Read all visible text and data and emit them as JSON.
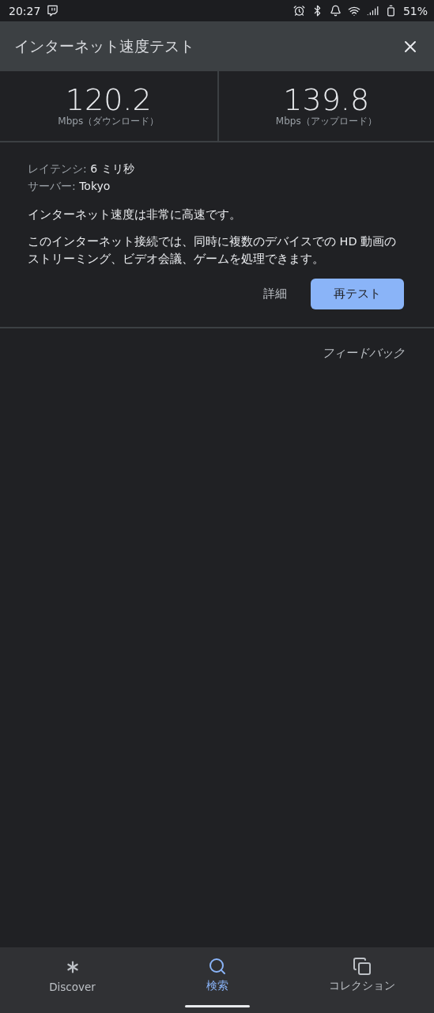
{
  "status_bar": {
    "time": "20:27",
    "battery": "51%"
  },
  "header": {
    "title": "インターネット速度テスト"
  },
  "results": [
    {
      "value": "120.2",
      "unit": "Mbps（ダウンロード）"
    },
    {
      "value": "139.8",
      "unit": "Mbps（アップロード）"
    }
  ],
  "details": [
    {
      "label": "レイテンシ:",
      "value": "6 ミリ秒"
    },
    {
      "label": "サーバー:",
      "value": "Tokyo"
    }
  ],
  "summary": "インターネット速度は非常に高速です。",
  "description": "このインターネット接続では、同時に複数のデバイスでの HD 動画のストリーミング、ビデオ会議、ゲームを処理できます。",
  "actions": {
    "details": "詳細",
    "retest": "再テスト"
  },
  "feedback": "フィードバック",
  "nav": [
    {
      "label": "Discover",
      "selected": false
    },
    {
      "label": "検索",
      "selected": true
    },
    {
      "label": "コレクション",
      "selected": false
    }
  ]
}
